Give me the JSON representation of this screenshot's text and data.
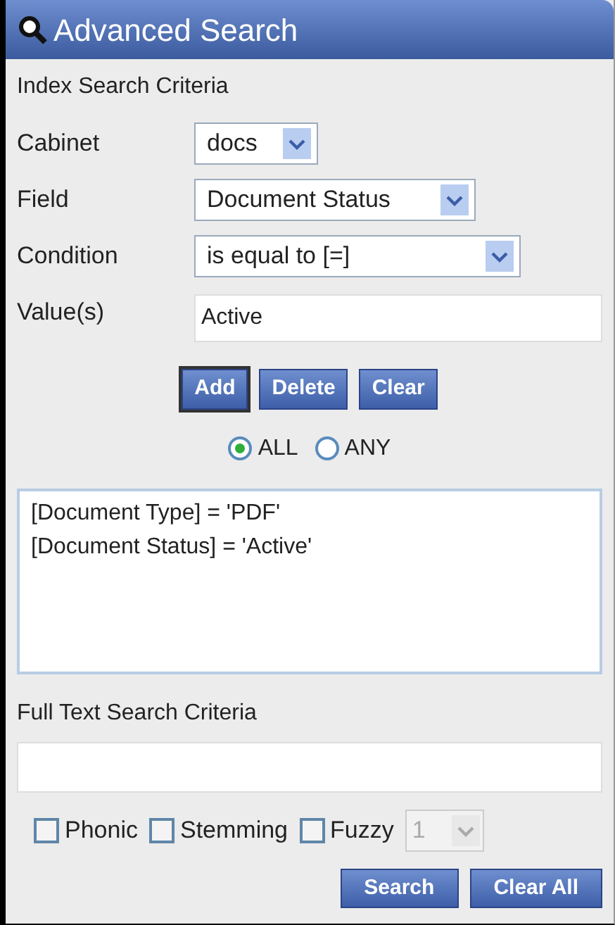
{
  "window": {
    "title": "Advanced Search"
  },
  "index_section": {
    "heading": "Index Search Criteria"
  },
  "fields": [
    {
      "kind": "select",
      "label": "Cabinet",
      "value": "docs"
    },
    {
      "kind": "select",
      "label": "Field",
      "value": "Document Status"
    },
    {
      "kind": "select",
      "label": "Condition",
      "value": "is equal to [=]"
    },
    {
      "kind": "text",
      "label": "Value(s)",
      "value": "Active"
    }
  ],
  "criteria_buttons": [
    {
      "label": "Add",
      "focused": true
    },
    {
      "label": "Delete",
      "focused": false
    },
    {
      "label": "Clear",
      "focused": false
    }
  ],
  "match_mode": [
    {
      "label": "ALL",
      "selected": true
    },
    {
      "label": "ANY",
      "selected": false
    }
  ],
  "criteria_list": [
    "[Document Type] = 'PDF'",
    "[Document Status] = 'Active'"
  ],
  "full_text": {
    "heading": "Full Text Search Criteria"
  },
  "options": [
    {
      "label": "Phonic",
      "checked": false
    },
    {
      "label": "Stemming",
      "checked": false
    },
    {
      "label": "Fuzzy",
      "checked": false
    }
  ],
  "fuzzy_level": {
    "value": "1",
    "disabled": true
  },
  "action_buttons": [
    "Search",
    "Clear All"
  ]
}
